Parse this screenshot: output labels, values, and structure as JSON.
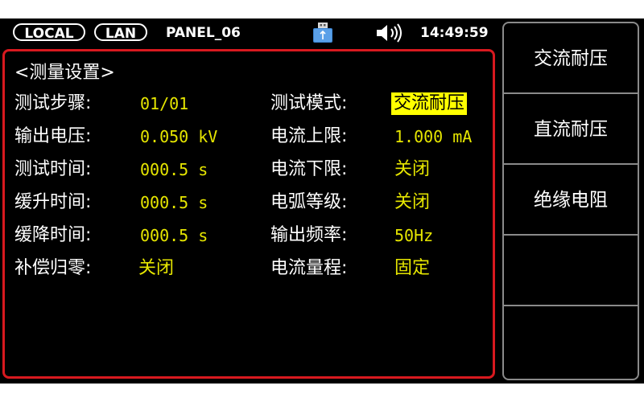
{
  "status_bar": {
    "local_label": "LOCAL",
    "lan_label": "LAN",
    "panel_name": "PANEL_06",
    "time": "14:49:59",
    "usb_icon": "usb-drive-icon",
    "speaker_icon": "speaker-volume-icon"
  },
  "panel": {
    "title": "<测量设置>",
    "fields": [
      {
        "label": "测试步骤:",
        "value": "01/01"
      },
      {
        "label": "输出电压:",
        "value": "0.050 kV"
      },
      {
        "label": "测试时间:",
        "value": "000.5 s"
      },
      {
        "label": "缓升时间:",
        "value": "000.5 s"
      },
      {
        "label": "缓降时间:",
        "value": "000.5 s"
      },
      {
        "label": "补偿归零:",
        "value": "关闭"
      },
      {
        "label": "测试模式:",
        "value": "交流耐压"
      },
      {
        "label": "电流上限:",
        "value": "1.000 mA"
      },
      {
        "label": "电流下限:",
        "value": "关闭"
      },
      {
        "label": "电弧等级:",
        "value": "关闭"
      },
      {
        "label": "输出频率:",
        "value": "50Hz"
      },
      {
        "label": "电流量程:",
        "value": "固定"
      }
    ]
  },
  "softkeys": [
    {
      "label": "交流耐压"
    },
    {
      "label": "直流耐压"
    },
    {
      "label": "绝缘电阻"
    },
    {
      "label": ""
    },
    {
      "label": ""
    }
  ],
  "colors": {
    "value_yellow": "#e6e600",
    "highlight": "#ffff00",
    "border_red": "#d8191f",
    "divider_gray": "#8a8a8a"
  }
}
